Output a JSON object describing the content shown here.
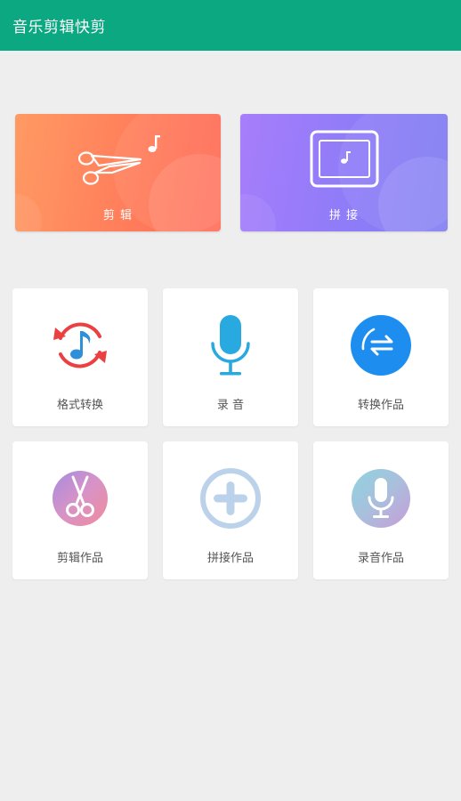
{
  "app": {
    "title": "音乐剪辑快剪"
  },
  "feature_cards": [
    {
      "label": "剪 辑",
      "icon": "scissors-music-icon",
      "colors": [
        "#ff9a63",
        "#ff6a56"
      ]
    },
    {
      "label": "拼 接",
      "icon": "frame-music-icon",
      "colors": [
        "#a77dfb",
        "#7f7cf2"
      ]
    }
  ],
  "tools": [
    {
      "label": "格式转换",
      "icon": "format-convert-icon"
    },
    {
      "label": "录 音",
      "icon": "microphone-icon"
    },
    {
      "label": "转换作品",
      "icon": "swap-arrows-icon"
    },
    {
      "label": "剪辑作品",
      "icon": "scissors-icon"
    },
    {
      "label": "拼接作品",
      "icon": "plus-circle-icon"
    },
    {
      "label": "录音作品",
      "icon": "mic-circle-icon"
    }
  ],
  "colors": {
    "app_bar": "#0ca882",
    "background": "#eeeeee"
  }
}
